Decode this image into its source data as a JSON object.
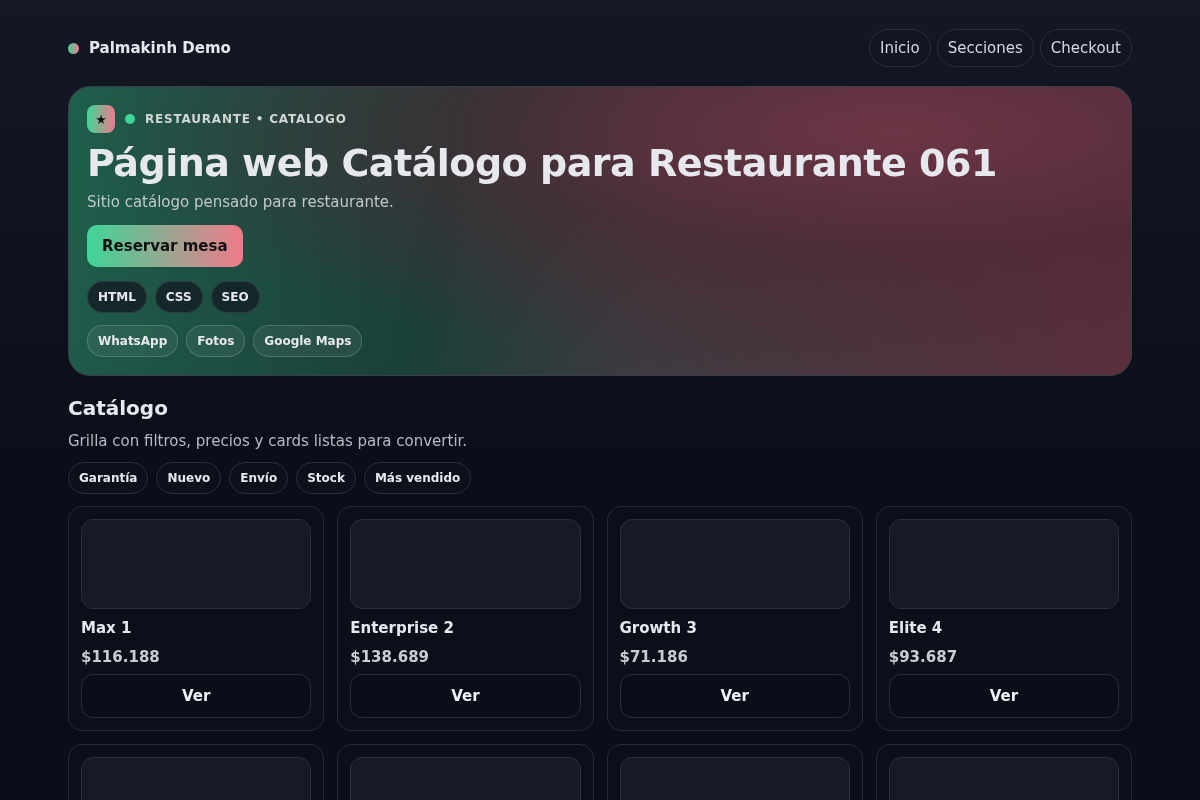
{
  "brand": {
    "name": "Palmakinh Demo"
  },
  "nav": [
    {
      "label": "Inicio"
    },
    {
      "label": "Secciones"
    },
    {
      "label": "Checkout"
    }
  ],
  "hero": {
    "badge": "★",
    "eyebrow": "RESTAURANTE • CATALOGO",
    "title": "Página web Catálogo para Restaurante 061",
    "subtitle": "Sitio catálogo pensado para restaurante.",
    "cta": "Reservar mesa",
    "tech_tags": [
      "HTML",
      "CSS",
      "SEO"
    ],
    "feature_tags": [
      "WhatsApp",
      "Fotos",
      "Google Maps"
    ]
  },
  "catalog": {
    "title": "Catálogo",
    "subtitle": "Grilla con filtros, precios y cards listas para convertir.",
    "filters": [
      "Garantía",
      "Nuevo",
      "Envío",
      "Stock",
      "Más vendido"
    ],
    "cards": [
      {
        "kind": "full",
        "name": "Max 1",
        "price": "$116.188",
        "button": "Ver"
      },
      {
        "kind": "full",
        "name": "Enterprise 2",
        "price": "$138.689",
        "button": "Ver"
      },
      {
        "kind": "full",
        "name": "Growth 3",
        "price": "$71.186",
        "button": "Ver"
      },
      {
        "kind": "full",
        "name": "Elite 4",
        "price": "$93.687",
        "button": "Ver"
      },
      {
        "kind": "cut"
      },
      {
        "kind": "cut"
      },
      {
        "kind": "cut"
      },
      {
        "kind": "cut"
      }
    ]
  }
}
